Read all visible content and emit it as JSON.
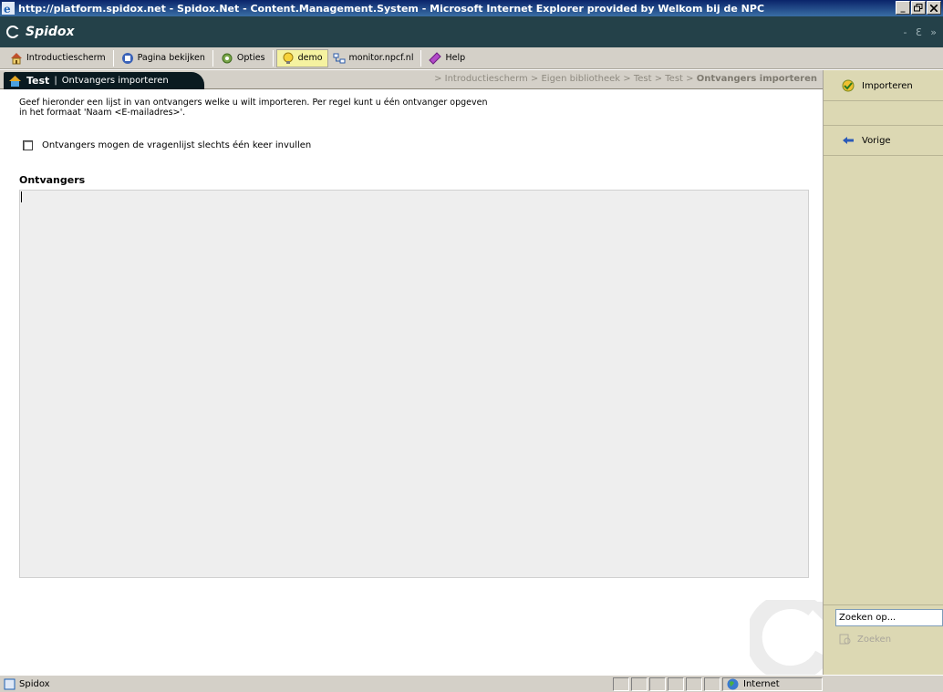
{
  "window": {
    "title": "http://platform.spidox.net - Spidox.Net - Content.Management.System - Microsoft Internet Explorer provided by Welkom bij de NPC",
    "controls": [
      "_",
      " ",
      " "
    ]
  },
  "app": {
    "name": "Spidox",
    "header_controls": "- Ɛ »"
  },
  "toolbar": {
    "items": [
      {
        "label": "Introductiescherm",
        "icon": "home-icon"
      },
      {
        "label": "Pagina bekijken",
        "icon": "view-page-icon"
      },
      {
        "label": "Opties",
        "icon": "options-icon"
      },
      {
        "label": "demo",
        "icon": "bulb-icon"
      },
      {
        "label": "monitor.npcf.nl",
        "icon": "network-icon"
      },
      {
        "label": "Help",
        "icon": "help-icon"
      }
    ]
  },
  "breadcrumb": {
    "tab_title": "Test",
    "tab_separator": "|",
    "tab_subtitle": "Ontvangers importeren",
    "path": "> Introductiescherm > Eigen bibliotheek > Test > Test > ",
    "current": "Ontvangers importeren"
  },
  "main": {
    "intro_line1": "Geef hieronder een lijst in van ontvangers welke u wilt importeren. Per regel kunt u één ontvanger opgeven",
    "intro_line2": "in het formaat 'Naam <E-mailadres>'.",
    "checkbox_label": "Ontvangers mogen de vragenlijst slechts één keer invullen",
    "checkbox_checked": false,
    "section_title": "Ontvangers",
    "textarea_value": ""
  },
  "side": {
    "import_label": "Importeren",
    "back_label": "Vorige",
    "search_value": "Zoeken op...",
    "search_button": "Zoeken"
  },
  "statusbar": {
    "left": "Spidox",
    "zone": "Internet"
  }
}
